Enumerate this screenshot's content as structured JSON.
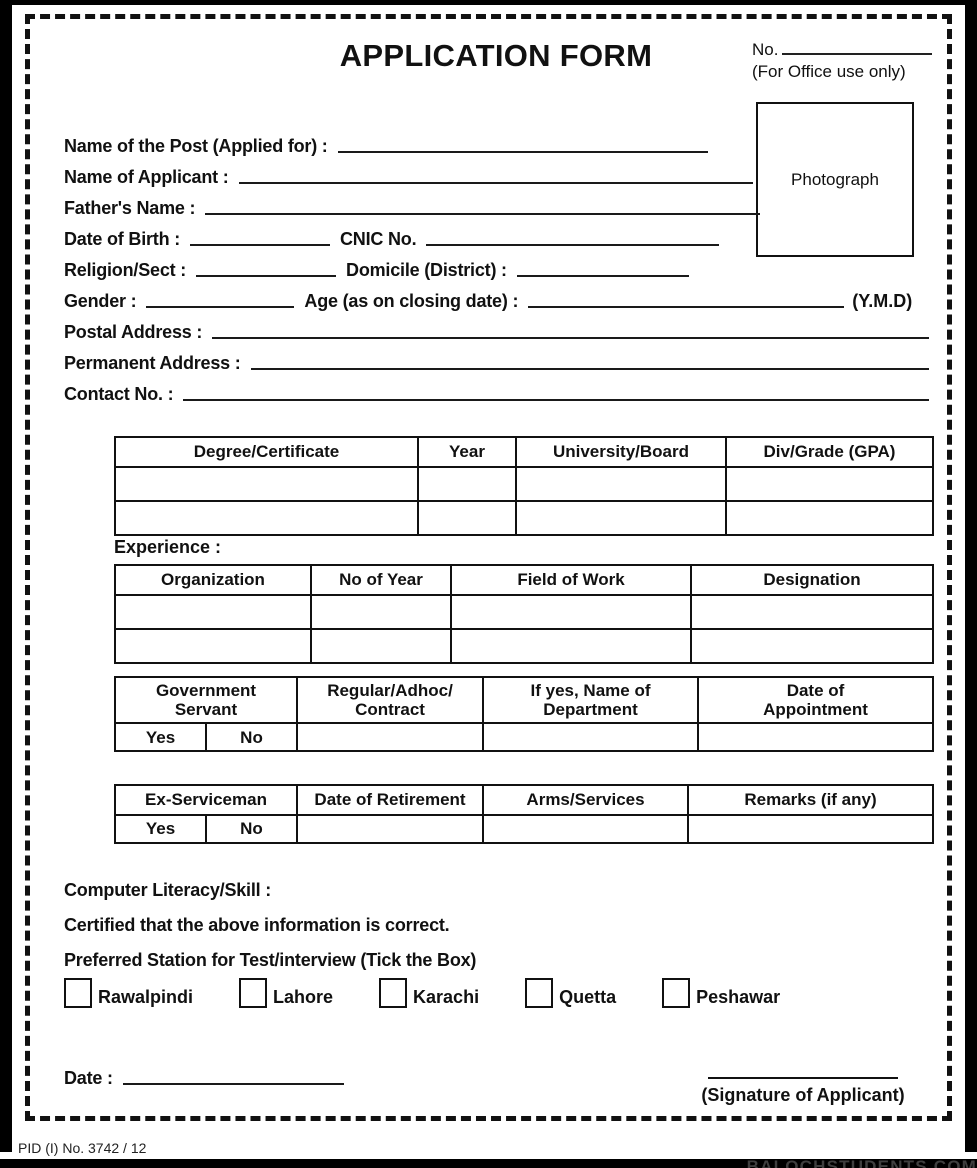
{
  "document": {
    "title": "APPLICATION FORM",
    "footer_pid": "PID (I) No. 3742 / 12",
    "watermark": "BALOCHSTUDENTS.COM"
  },
  "office_use": {
    "no_label": "No.",
    "note": "(For Office use only)",
    "photograph_label": "Photograph"
  },
  "fields": {
    "post": "Name of the Post (Applied for) :",
    "applicant": "Name of Applicant :",
    "father": "Father's Name :",
    "dob": "Date of Birth :",
    "cnic": "CNIC No.",
    "religion": "Religion/Sect :",
    "domicile": "Domicile (District) :",
    "gender": "Gender :",
    "age": "Age (as on closing date) :",
    "ymd": "(Y.M.D)",
    "postal_address": "Postal Address :",
    "permanent_address": "Permanent Address :",
    "contact": "Contact No. :"
  },
  "education_table": {
    "headers": [
      "Degree/Certificate",
      "Year",
      "University/Board",
      "Div/Grade (GPA)"
    ],
    "rows": [
      [
        "",
        "",
        "",
        ""
      ],
      [
        "",
        "",
        "",
        ""
      ]
    ]
  },
  "experience": {
    "label": "Experience :",
    "headers": [
      "Organization",
      "No of Year",
      "Field of Work",
      "Designation"
    ],
    "rows": [
      [
        "",
        "",
        "",
        ""
      ],
      [
        "",
        "",
        "",
        ""
      ]
    ]
  },
  "government_servant": {
    "headers": [
      "Government Servant",
      "Regular/Adhoc/ Contract",
      "If yes, Name of Department",
      "Date of Appointment"
    ],
    "header_lines": [
      [
        "Government",
        "Servant"
      ],
      [
        "Regular/Adhoc/",
        "Contract"
      ],
      [
        "If yes, Name of",
        "Department"
      ],
      [
        "Date of",
        "Appointment"
      ]
    ],
    "yes_label": "Yes",
    "no_label": "No"
  },
  "ex_serviceman": {
    "headers": [
      "Ex-Serviceman",
      "Date of Retirement",
      "Arms/Services",
      "Remarks (if any)"
    ],
    "yes_label": "Yes",
    "no_label": "No"
  },
  "declaration": {
    "computer_literacy": "Computer Literacy/Skill :",
    "certified": "Certified that the above information is correct.",
    "preferred_station": "Preferred Station for Test/interview (Tick the Box)"
  },
  "stations": [
    {
      "name": "Rawalpindi",
      "checked": false
    },
    {
      "name": "Lahore",
      "checked": false
    },
    {
      "name": "Karachi",
      "checked": false
    },
    {
      "name": "Quetta",
      "checked": false
    },
    {
      "name": "Peshawar",
      "checked": false
    }
  ],
  "signature": {
    "date_label": "Date :",
    "signature_label": "(Signature of Applicant)"
  },
  "colors": {
    "ink": "#111111",
    "rule": "#1a1a1a",
    "paper": "#ffffff"
  }
}
